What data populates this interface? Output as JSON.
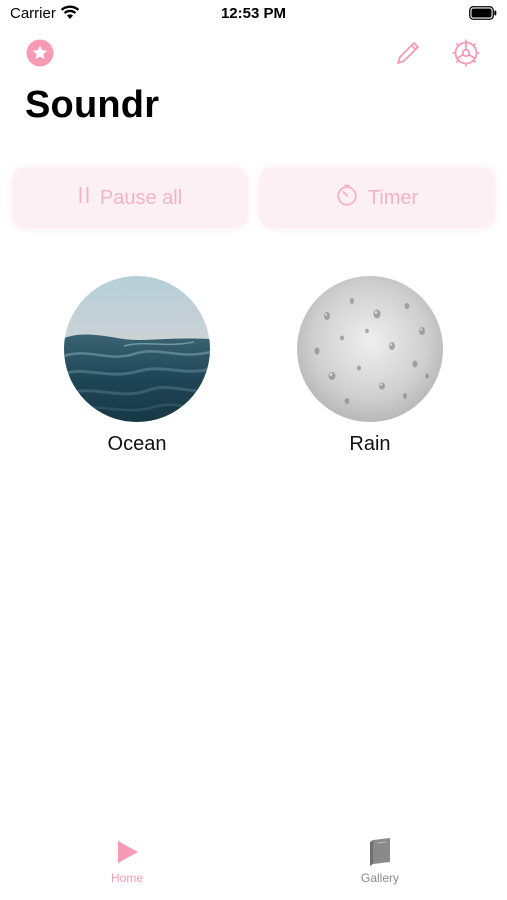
{
  "status_bar": {
    "carrier": "Carrier",
    "time": "12:53 PM"
  },
  "header": {
    "title": "Soundr",
    "star_icon": "star-icon",
    "edit_icon": "pencil-icon",
    "settings_icon": "gear-icon"
  },
  "actions": {
    "pause_label": "Pause all",
    "pause_icon": "pause-icon",
    "timer_label": "Timer",
    "timer_icon": "timer-icon"
  },
  "sounds": [
    {
      "label": "Ocean",
      "image": "ocean-waves"
    },
    {
      "label": "Rain",
      "image": "rain-drops-on-glass"
    }
  ],
  "tab_bar": {
    "home_label": "Home",
    "home_icon": "play-icon",
    "gallery_label": "Gallery",
    "gallery_icon": "book-icon"
  },
  "colors": {
    "accent": "#f79ab4",
    "accent_light": "#fdf0f4",
    "inactive": "#8a8a8a"
  }
}
